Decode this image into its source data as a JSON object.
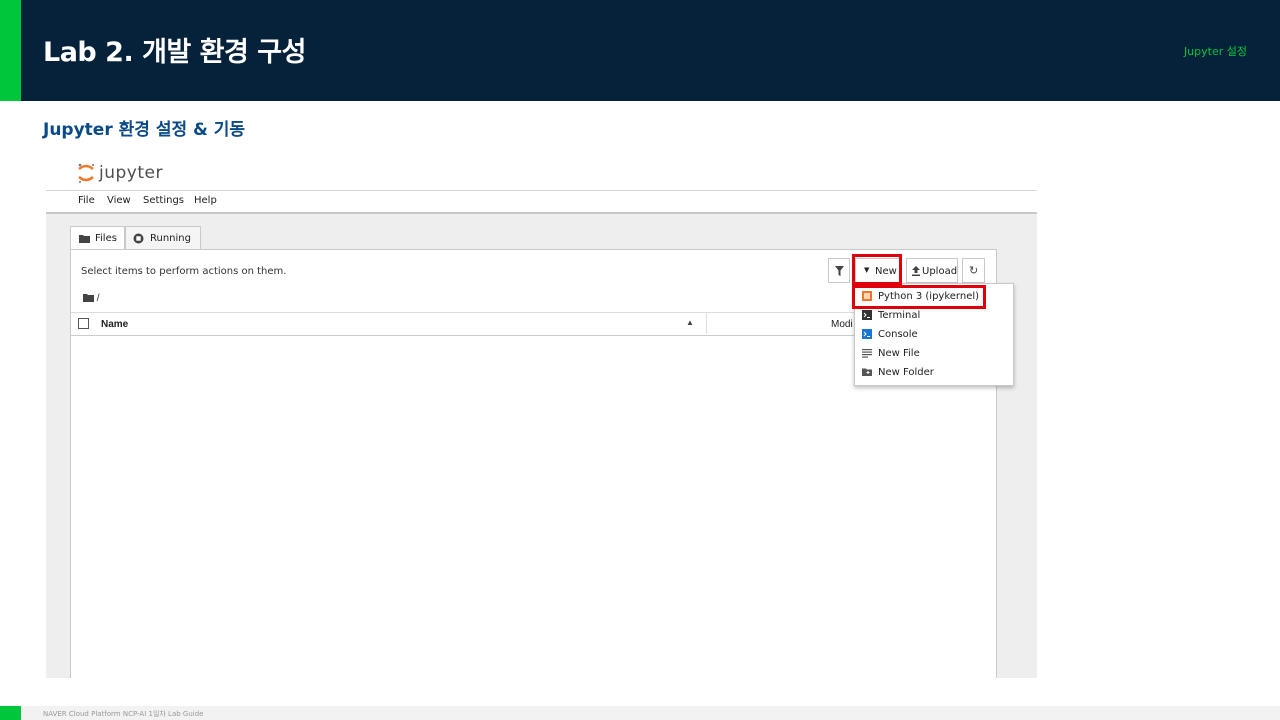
{
  "slide": {
    "title": "Lab 2. 개발 환경 구성",
    "tag": "Jupyter 설정",
    "section_title": "Jupyter 환경 설정 & 기동",
    "footer": "NAVER Cloud Platform  NCP-AI 1일차 Lab Guide"
  },
  "jupyter": {
    "logo_text": "jupyter",
    "menu": [
      "File",
      "View",
      "Settings",
      "Help"
    ],
    "tabs": [
      {
        "label": "Files",
        "icon": "folder-icon"
      },
      {
        "label": "Running",
        "icon": "stop-circle-icon"
      }
    ],
    "select_message": "Select items to perform actions on them.",
    "toolbar": {
      "filter_icon": "filter-icon",
      "new_label": "New",
      "upload_label": "Upload",
      "refresh_icon": "refresh-icon"
    },
    "breadcrumb_path": "/",
    "columns": {
      "name": "Name",
      "modified": "Modi"
    },
    "new_menu": [
      {
        "label": "Python 3 (ipykernel)",
        "icon": "python-notebook-icon"
      },
      {
        "label": "Terminal",
        "icon": "terminal-icon"
      },
      {
        "label": "Console",
        "icon": "console-icon"
      },
      {
        "label": "New File",
        "icon": "text-file-icon"
      },
      {
        "label": "New Folder",
        "icon": "new-folder-icon"
      }
    ]
  },
  "colors": {
    "header_bg": "#06213a",
    "accent_green": "#00c63b",
    "section_blue": "#0a4a86",
    "highlight_red": "#e0000b",
    "jupyter_orange": "#f37726"
  }
}
